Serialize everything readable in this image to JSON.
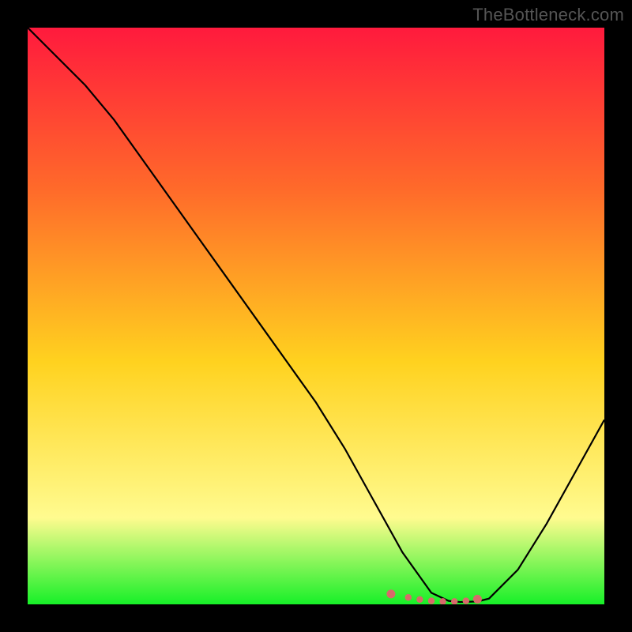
{
  "watermark": "TheBottleneck.com",
  "colors": {
    "frame_background": "#000000",
    "gradient_top": "#ff1a3d",
    "gradient_mid1": "#ff6a2a",
    "gradient_mid2": "#ffd21f",
    "gradient_mid3": "#fffb8f",
    "gradient_bottom": "#17f028",
    "curve_stroke": "#000000",
    "dots_fill": "#d86a6a"
  },
  "chart_data": {
    "type": "line",
    "title": "",
    "xlabel": "",
    "ylabel": "",
    "xlim": [
      0,
      100
    ],
    "ylim": [
      0,
      100
    ],
    "x": [
      0,
      5,
      10,
      15,
      20,
      25,
      30,
      35,
      40,
      45,
      50,
      55,
      60,
      65,
      70,
      73,
      75,
      78,
      80,
      85,
      90,
      95,
      100
    ],
    "values": [
      100,
      95,
      90,
      84,
      77,
      70,
      63,
      56,
      49,
      42,
      35,
      27,
      18,
      9,
      2,
      0.6,
      0.4,
      0.5,
      1,
      6,
      14,
      23,
      32
    ],
    "dots": {
      "x": [
        63,
        66,
        68,
        70,
        72,
        74,
        76,
        78
      ],
      "y": [
        1.8,
        1.2,
        0.85,
        0.6,
        0.5,
        0.5,
        0.6,
        0.9
      ]
    }
  }
}
